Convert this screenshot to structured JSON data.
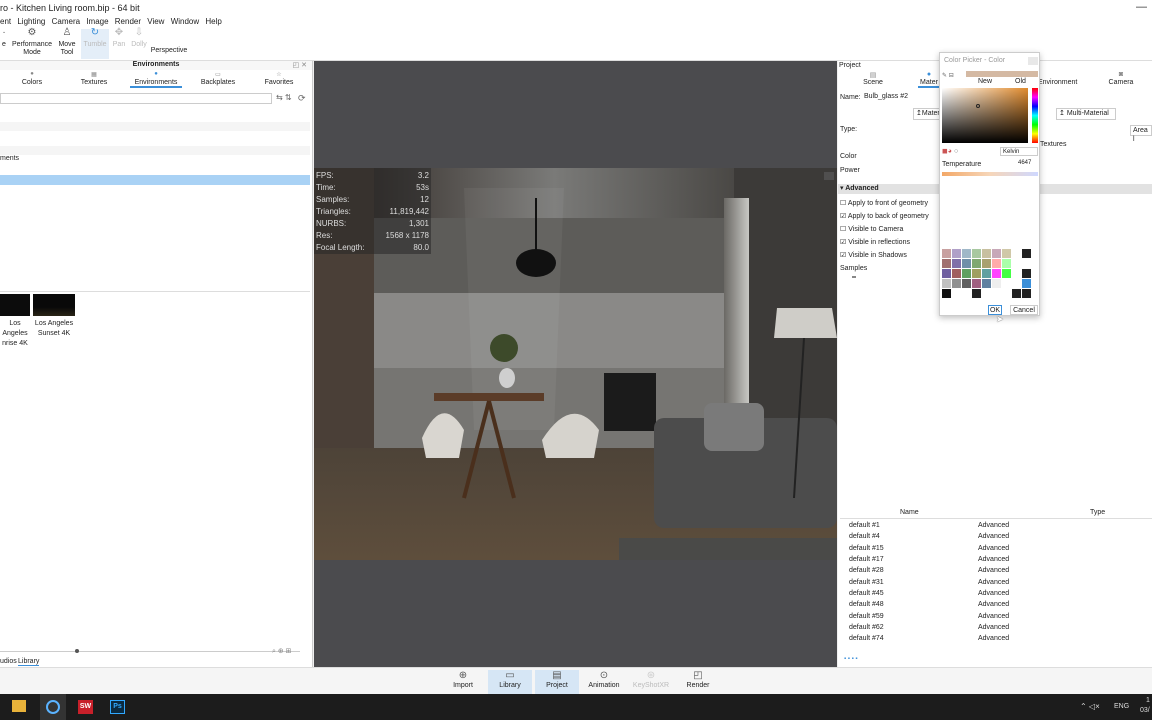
{
  "window": {
    "title": "ro  - Kitchen Living room.bip  - 64 bit",
    "minimize": "—"
  },
  "menu": [
    "ent",
    "Lighting",
    "Camera",
    "Image",
    "Render",
    "View",
    "Window",
    "Help"
  ],
  "toolbar": {
    "items": [
      {
        "label": "e",
        "icon": "partial-icon"
      },
      {
        "label": "Performance Mode",
        "icon": "gear-icon"
      },
      {
        "label": "Move Tool",
        "icon": "move-icon"
      },
      {
        "label": "Tumble",
        "icon": "tumble-icon"
      },
      {
        "label": "Pan",
        "icon": "pan-icon"
      },
      {
        "label": "Dolly",
        "icon": "dolly-icon"
      },
      {
        "label": "Perspective",
        "icon": ""
      }
    ]
  },
  "left_panel": {
    "title": "Environments",
    "tabs": [
      "Colors",
      "Textures",
      "Environments",
      "Backplates",
      "Favorites"
    ],
    "active_tab": "Environments",
    "tree_item": "ments",
    "thumbnails": [
      {
        "line1": "Los Angeles",
        "line2": "nrise 4K"
      },
      {
        "line1": "Los Angeles",
        "line2": "Sunset 4K"
      }
    ],
    "bottom_tabs": [
      "udios",
      "Library"
    ]
  },
  "hud": {
    "rows": [
      {
        "k": "FPS:",
        "v": "3.2"
      },
      {
        "k": "Time:",
        "v": "53s"
      },
      {
        "k": "Samples:",
        "v": "12"
      },
      {
        "k": "Triangles:",
        "v": "11,819,442"
      },
      {
        "k": "NURBS:",
        "v": "1,301"
      },
      {
        "k": "Res:",
        "v": "1568 x 1178"
      },
      {
        "k": "Focal Length:",
        "v": "80.0"
      }
    ]
  },
  "right_panel": {
    "title": "Project",
    "tabs": [
      "Scene",
      "Mater",
      "Environment",
      "Camera"
    ],
    "name_label": "Name:",
    "name_value": "Bulb_glass #2",
    "mater_button": "Mater",
    "multi_material": "Multi-Material",
    "type_label": "Type:",
    "type_value": "Area l",
    "textures": "Textures",
    "color_label": "Color",
    "power_label": "Power",
    "advanced": "Advanced",
    "checkboxes": [
      {
        "label": "Apply to front of geometry",
        "checked": false
      },
      {
        "label": "Apply to back of geometry",
        "checked": true
      },
      {
        "label": "Visible to Camera",
        "checked": false
      },
      {
        "label": "Visible in reflections",
        "checked": true
      },
      {
        "label": "Visible in Shadows",
        "checked": true
      }
    ],
    "samples": "Samples",
    "table_headers": [
      "Name",
      "Type"
    ],
    "rows": [
      {
        "name": "default #1",
        "type": "Advanced"
      },
      {
        "name": "default #4",
        "type": "Advanced"
      },
      {
        "name": "default #15",
        "type": "Advanced"
      },
      {
        "name": "default #17",
        "type": "Advanced"
      },
      {
        "name": "default #28",
        "type": "Advanced"
      },
      {
        "name": "default #31",
        "type": "Advanced"
      },
      {
        "name": "default #45",
        "type": "Advanced"
      },
      {
        "name": "default #48",
        "type": "Advanced"
      },
      {
        "name": "default #59",
        "type": "Advanced"
      },
      {
        "name": "default #62",
        "type": "Advanced"
      },
      {
        "name": "default #74",
        "type": "Advanced"
      }
    ]
  },
  "color_picker": {
    "title": "Color Picker - Color",
    "new": "New",
    "old": "Old",
    "mode": "Kelvin",
    "temp_label": "Temperature",
    "temp_value": "4647",
    "ok": "OK",
    "cancel": "Cancel",
    "swatches": [
      "#c8a0a0",
      "#b0a0c8",
      "#a0b8c8",
      "#a8c8a0",
      "#c8c0a0",
      "#c8a8b8",
      "#d0c8a8",
      "#fff",
      "#222",
      "#a07070",
      "#8070a8",
      "#7090a8",
      "#80a870",
      "#a8a070",
      "#ffaaaa",
      "#aaffaa",
      "#fff",
      "#fff",
      "#7060a0",
      "#a06060",
      "#60a060",
      "#a0a060",
      "#60a0a0",
      "#ff44ff",
      "#44ff44",
      "#fff",
      "#222",
      "#c0c0c0",
      "#909090",
      "#606060",
      "#a06080",
      "#6080a0",
      "#eeeeee",
      "#fff",
      "#fff",
      "#3b8fd9",
      "#111",
      "#fff",
      "#fff",
      "#222",
      "#fff",
      "#fff",
      "#fff",
      "#222",
      "#222"
    ],
    "hue_colors": [
      "#ff0000",
      "#ff00ff",
      "#0000ff",
      "#00ffff",
      "#00ff00",
      "#ffff00",
      "#ff0000"
    ]
  },
  "bottom_bar": {
    "items": [
      {
        "label": "Import",
        "icon": "import-icon",
        "active": false
      },
      {
        "label": "Library",
        "icon": "library-icon",
        "active": true
      },
      {
        "label": "Project",
        "icon": "project-icon",
        "active": true
      },
      {
        "label": "Animation",
        "icon": "animation-icon",
        "active": false
      },
      {
        "label": "KeyShotXR",
        "icon": "xr-icon",
        "active": false
      },
      {
        "label": "Render",
        "icon": "render-icon",
        "active": false
      }
    ]
  },
  "taskbar": {
    "lang": "ENG",
    "time": "1",
    "date": "03/"
  }
}
